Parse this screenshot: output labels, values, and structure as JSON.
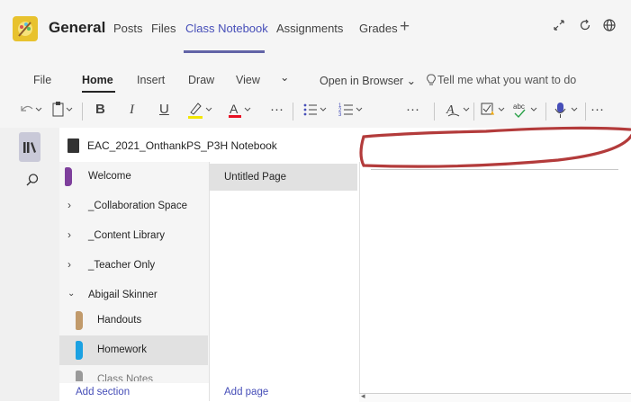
{
  "header": {
    "channel": "General",
    "tabs": [
      {
        "label": "Posts"
      },
      {
        "label": "Files"
      },
      {
        "label": "Class Notebook",
        "active": true
      },
      {
        "label": "Assignments"
      },
      {
        "label": "Grades"
      }
    ],
    "add_tab": "+"
  },
  "ribbon": {
    "tabs": [
      {
        "label": "File"
      },
      {
        "label": "Home",
        "active": true
      },
      {
        "label": "Insert"
      },
      {
        "label": "Draw"
      },
      {
        "label": "View"
      }
    ],
    "more": "⌄",
    "open_in_browser": "Open in Browser ⌄",
    "tell_me": "Tell me what you want to do"
  },
  "notebook": {
    "name": "EAC_2021_OnthankPS_P3H Notebook",
    "sections": [
      {
        "label": "Welcome",
        "color": "#7e3f9c"
      },
      {
        "label": "_Collaboration Space"
      },
      {
        "label": "_Content Library"
      },
      {
        "label": "_Teacher Only"
      },
      {
        "label": "Abigail Skinner"
      },
      {
        "label": "Handouts",
        "color": "#c19a6b"
      },
      {
        "label": "Homework",
        "color": "#1ba1e2",
        "selected": true
      },
      {
        "label": "Class Notes",
        "color": "#9a9a9a"
      }
    ],
    "add_section": "Add section",
    "pages": [
      {
        "label": "Untitled Page"
      }
    ],
    "add_page": "Add page"
  },
  "colors": {
    "accent": "#6264a7",
    "annotation": "#b33b3b"
  }
}
